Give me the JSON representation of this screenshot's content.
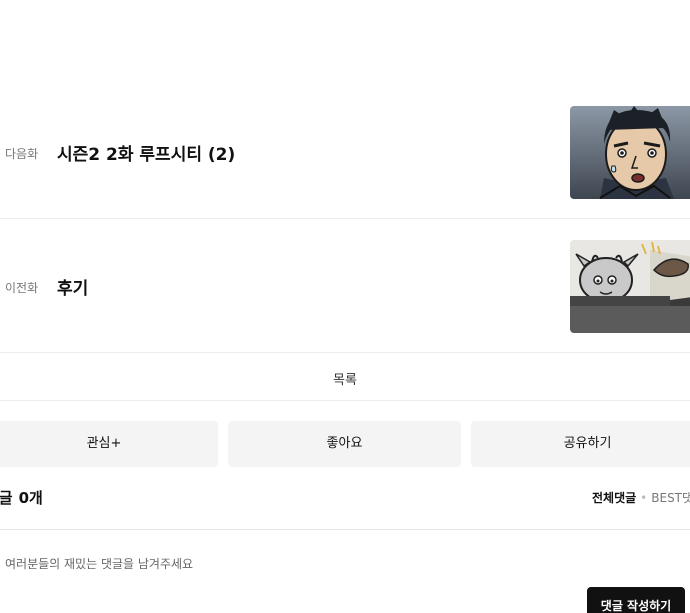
{
  "episodes": {
    "next": {
      "label": "다음화",
      "title": "시즌2 2화 루프시티 (2)",
      "thumbnail": "manga-face-portrait"
    },
    "prev": {
      "label": "이전화",
      "title": "후기",
      "thumbnail": "manga-cow-character"
    }
  },
  "list_label": "목록",
  "actions": {
    "interest": "관심+",
    "like": "좋아요",
    "share": "공유하기"
  },
  "comments": {
    "title": "댓글",
    "count": "0개",
    "sort_all": "전체댓글",
    "sort_separator": "•",
    "sort_best": "BEST댓글",
    "placeholder": "여러분들의 재밌는 댓글을 남겨주세요",
    "write_button": "댓글 작성하기"
  },
  "colors": {
    "button_bg": "#f4f4f4",
    "primary_dark": "#111111",
    "border": "#ececec"
  }
}
